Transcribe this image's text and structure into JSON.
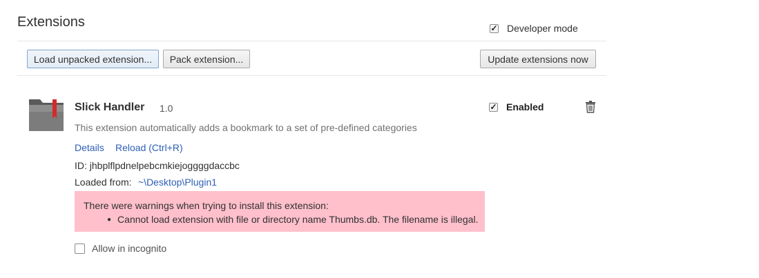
{
  "header": {
    "title": "Extensions",
    "developer_mode_label": "Developer mode",
    "developer_mode_checked": true
  },
  "toolbar": {
    "load_unpacked_label": "Load unpacked extension...",
    "pack_label": "Pack extension...",
    "update_label": "Update extensions now"
  },
  "extension": {
    "name": "Slick Handler",
    "version": "1.0",
    "description": "This extension automatically adds a bookmark to a set of pre-defined categories",
    "details_link": "Details",
    "reload_link": "Reload (Ctrl+R)",
    "id_text": "ID: jhbplflpdnelpebcmkiejoggggdaccbc",
    "loaded_from_label": "Loaded from:",
    "loaded_from_path": "~\\Desktop\\Plugin1",
    "enabled_label": "Enabled",
    "enabled_checked": true,
    "warning_title": "There were warnings when trying to install this extension:",
    "warning_item": "Cannot load extension with file or directory name Thumbs.db. The filename is illegal.",
    "incognito_label": "Allow in incognito",
    "incognito_checked": false
  },
  "colors": {
    "warning_bg": "#ffc0cb",
    "link": "#2d5fb5"
  }
}
